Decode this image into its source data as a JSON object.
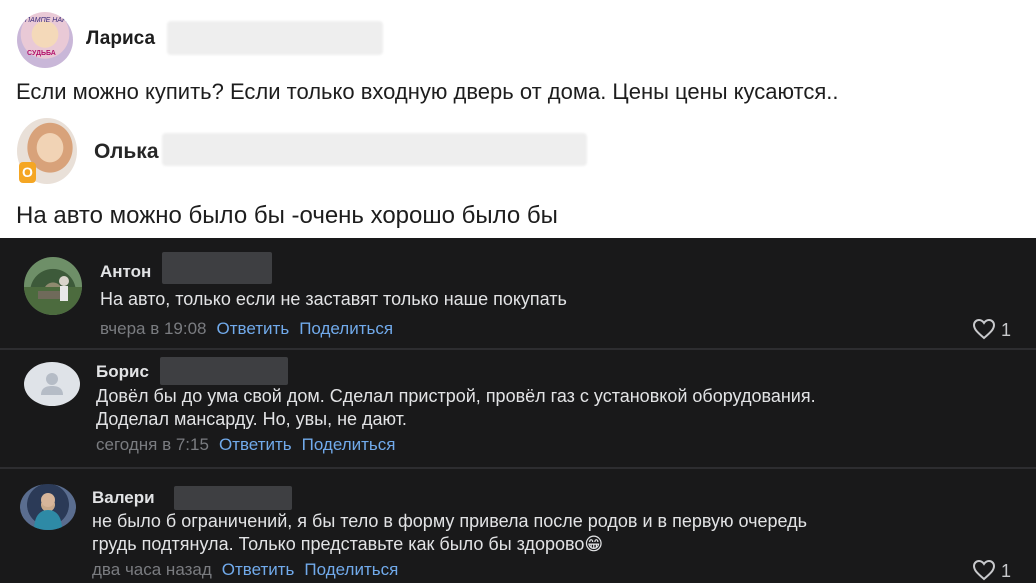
{
  "light_comments": [
    {
      "name": "Лариса",
      "avatar_text": [
        "ПАМПЕ НАРА",
        "СУДЬБА"
      ],
      "text": "Если можно купить? Если только входную дверь от дома. Цены цены кусаются.."
    },
    {
      "name": "Олька",
      "badge": "O",
      "text": "На авто можно было бы -очень хорошо было бы"
    }
  ],
  "dark_comments": [
    {
      "name": "Антон",
      "lines": [
        "На авто, только если не заставят только наше покупать"
      ],
      "time": "вчера в 19:08",
      "reply_label": "Ответить",
      "share_label": "Поделиться",
      "likes": "1"
    },
    {
      "name": "Борис",
      "lines": [
        "Довёл бы до ума свой дом. Сделал пристрой, провёл газ с установкой оборудования.",
        "Доделал мансарду. Но, увы, не дают."
      ],
      "time": "сегодня в 7:15",
      "reply_label": "Ответить",
      "share_label": "Поделиться"
    },
    {
      "name": "Валери",
      "lines": [
        "не было б ограничений, я бы тело в форму привела после родов и в первую очередь",
        "грудь подтянула. Только представьте как было бы здорово😁"
      ],
      "time": "два часа назад",
      "reply_label": "Ответить",
      "share_label": "Поделиться",
      "likes": "1"
    }
  ],
  "colors": {
    "dark_bg": "#19191a",
    "link": "#71aaeb",
    "muted": "#7a7c80"
  },
  "icons": [
    "heart-icon",
    "user-placeholder-icon"
  ]
}
